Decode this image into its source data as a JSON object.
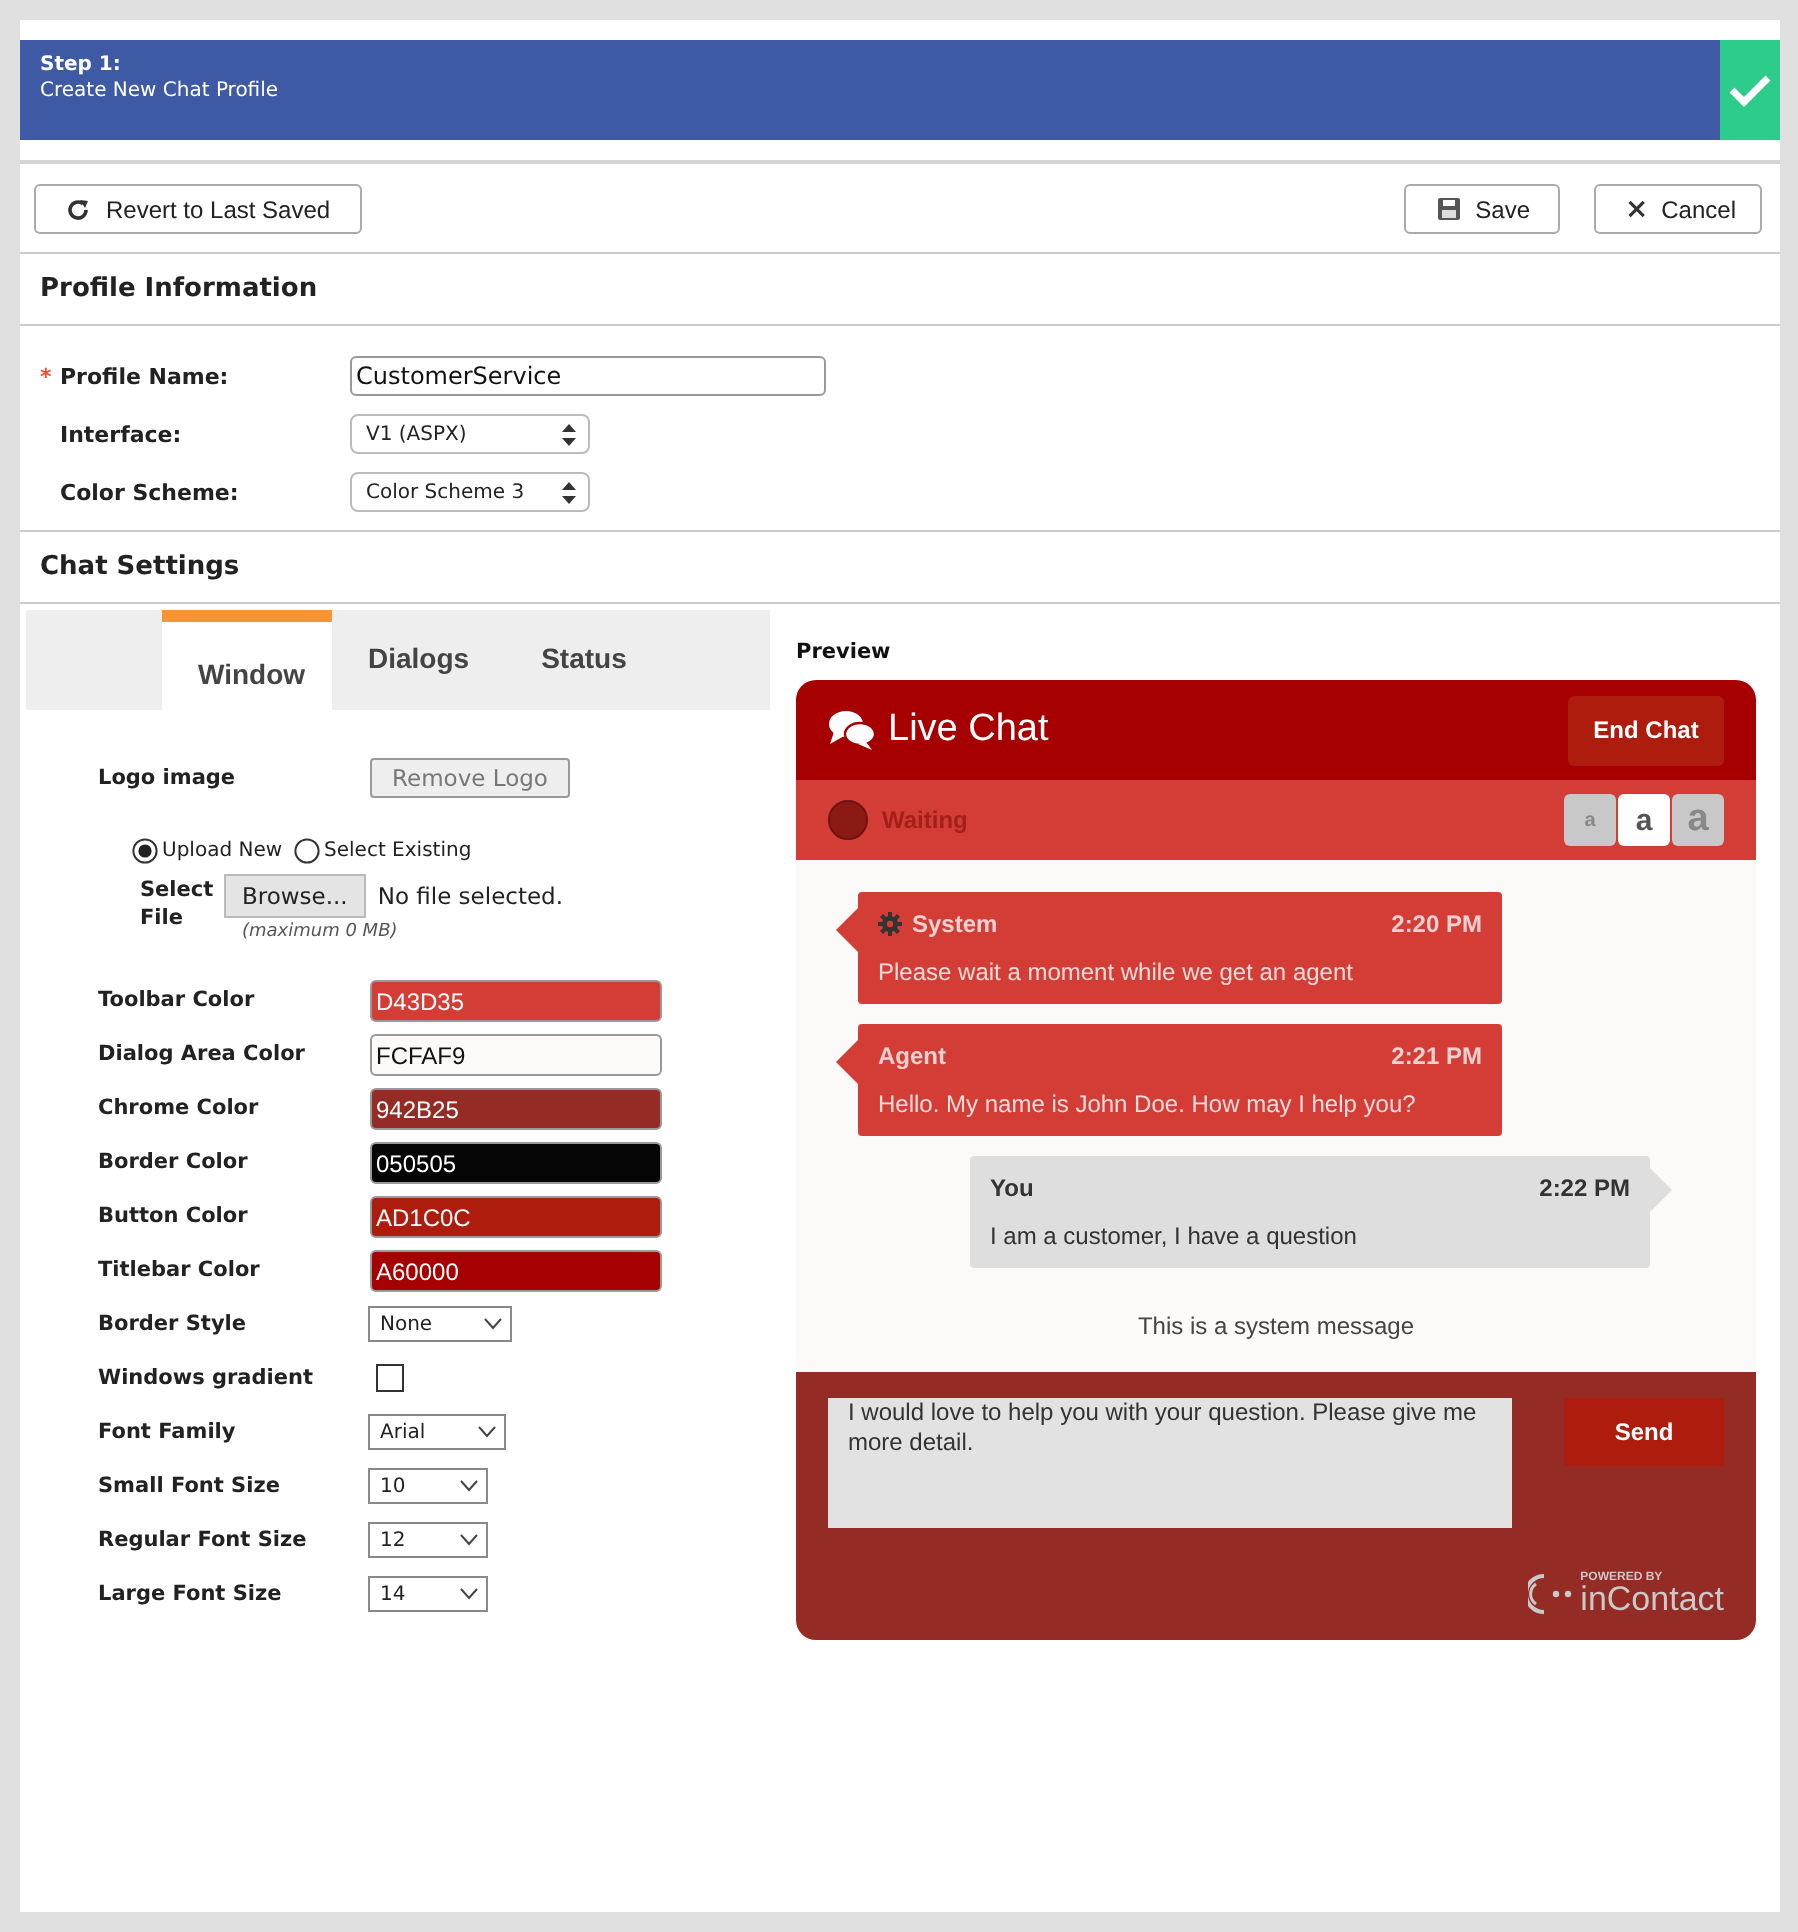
{
  "header": {
    "step": "Step 1:",
    "title": "Create New Chat Profile",
    "complete": true
  },
  "toolbar": {
    "revert": "Revert to Last Saved",
    "save": "Save",
    "cancel": "Cancel"
  },
  "profile": {
    "heading": "Profile Information",
    "fields": [
      {
        "kind": "text",
        "label": "Profile Name:",
        "required_mark": "*",
        "value": "CustomerService"
      },
      {
        "kind": "select",
        "label": "Interface:",
        "value": "V1 (ASPX)"
      },
      {
        "kind": "select",
        "label": "Color Scheme:",
        "value": "Color Scheme 3"
      }
    ]
  },
  "chat_settings": {
    "heading": "Chat Settings",
    "tabs": [
      {
        "label": "Window",
        "selected": true
      },
      {
        "label": "Dialogs",
        "selected": false
      },
      {
        "label": "Status",
        "selected": false
      }
    ],
    "logo": {
      "label": "Logo image",
      "remove": "Remove Logo",
      "options": [
        {
          "label": "Upload New",
          "selected": true
        },
        {
          "label": "Select Existing",
          "selected": false
        }
      ],
      "file_label": "Select File",
      "browse": "Browse...",
      "file_status": "No file selected.",
      "hint": "(maximum 0 MB)"
    },
    "settings": [
      {
        "kind": "color",
        "label": "Toolbar Color",
        "value": "D43D35",
        "color": "#d43d35"
      },
      {
        "kind": "color",
        "label": "Dialog Area Color",
        "value": "FCFAF9",
        "color": "#fcfaf9"
      },
      {
        "kind": "color",
        "label": "Chrome Color",
        "value": "942B25",
        "color": "#942b25"
      },
      {
        "kind": "color",
        "label": "Border Color",
        "value": "050505",
        "color": "#050505"
      },
      {
        "kind": "color",
        "label": "Button Color",
        "value": "AD1C0C",
        "color": "#ad1c0c"
      },
      {
        "kind": "color",
        "label": "Titlebar Color",
        "value": "A60000",
        "color": "#a60000"
      },
      {
        "kind": "select",
        "label": "Border Style",
        "value": "None"
      },
      {
        "kind": "checkbox",
        "label": "Windows gradient",
        "checked": false
      },
      {
        "kind": "select",
        "label": "Font Family",
        "value": "Arial"
      },
      {
        "kind": "select",
        "label": "Small Font Size",
        "value": "10"
      },
      {
        "kind": "select",
        "label": "Regular Font Size",
        "value": "12"
      },
      {
        "kind": "select",
        "label": "Large Font Size",
        "value": "14"
      }
    ]
  },
  "preview": {
    "heading": "Preview",
    "title": "Live Chat",
    "end_button": "End Chat",
    "status": "Waiting",
    "font_sizes": [
      {
        "label": "a",
        "selected": false
      },
      {
        "label": "a",
        "selected": true
      },
      {
        "label": "a",
        "selected": false
      }
    ],
    "messages": [
      {
        "kind": "system",
        "sender": "System",
        "time": "2:20 PM",
        "text": "Please wait a moment while we get an agent"
      },
      {
        "kind": "agent",
        "sender": "Agent",
        "time": "2:21 PM",
        "text": "Hello. My name is John Doe. How may I help you?"
      },
      {
        "kind": "customer",
        "sender": "You",
        "time": "2:22 PM",
        "text": "I am a customer, I have a question"
      }
    ],
    "system_message": "This is a system message",
    "input": "I would love to help you with your question. Please give me more detail.",
    "send": "Send",
    "powered_by": "POWERED BY",
    "brand": "inContact"
  }
}
